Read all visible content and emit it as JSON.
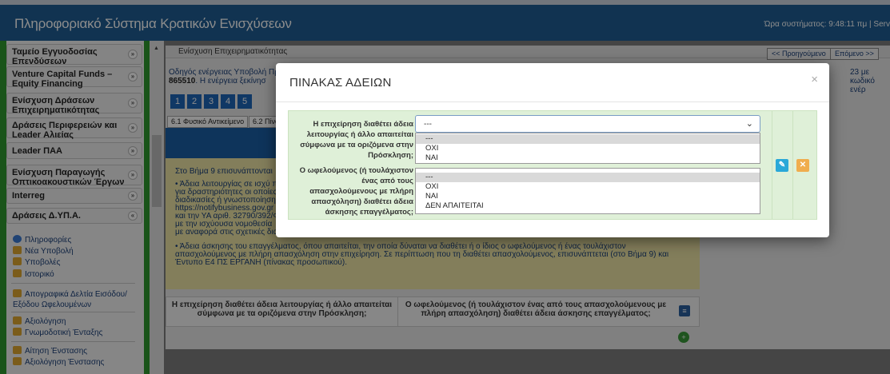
{
  "app": {
    "title": "Πληροφοριακό Σύστημα Κρατικών Ενισχύσεων",
    "clock": "Ώρα συστήματος: 9:48:11 πμ | Serv"
  },
  "sidebar": {
    "accordion": [
      {
        "label": "Ταμείο Εγγυοδοσίας Επενδύσεων (ΕΠΑνΕΚ/EIF)"
      },
      {
        "label": "Venture Capital Funds – Equity Financing"
      },
      {
        "label": "Ενίσχυση Δράσεων Επιχειρηματικότητας"
      },
      {
        "label": "Δράσεις Περιφερειών και Leader Αλιείας"
      },
      {
        "label": "Leader ΠΑΑ"
      },
      {
        "label": "Ενίσχυση Παραγωγής Οπτικοακουστικών Έργων"
      },
      {
        "label": "Interreg"
      },
      {
        "label": "Δράσεις Δ.ΥΠ.Α."
      }
    ],
    "menu": [
      {
        "label": "Πληροφορίες",
        "icon": "info-icon"
      },
      {
        "label": "Νέα Υποβολή",
        "icon": "folder-icon"
      },
      {
        "label": "Υποβολές",
        "icon": "folder-icon"
      },
      {
        "label": "Ιστορικό",
        "icon": "folder-icon"
      },
      {
        "label": "Απογραφικά Δελτία Εισόδου/ Εξόδου Ωφελουμένων",
        "icon": "folder-icon"
      },
      {
        "label": "Αξιολόγηση",
        "icon": "folder-icon"
      },
      {
        "label": "Γνωμοδοτική Ένταξης",
        "icon": "folder-icon"
      },
      {
        "label": "Αίτηση Ένστασης",
        "icon": "folder-icon"
      },
      {
        "label": "Αξιολόγηση Ένστασης",
        "icon": "folder-icon"
      }
    ]
  },
  "main": {
    "panel_title": "Ενίσχυση Επιχειρηματικότητας",
    "prev_label": "<< Προηγούμενο",
    "next_label": "Επόμενο >>",
    "guide_prefix": "Οδηγός ενέργειας Υποβολή Πρ",
    "guide_code": "865510",
    "guide_rest": ". Η ενέργεια ξεκίνησ",
    "guide_right": "23  με κωδικό ενέρ",
    "steps": [
      "1",
      "2",
      "3",
      "4",
      "5"
    ],
    "subtabs": [
      "6.1 Φυσικό Αντικείμενο",
      "6.2 Πίνα"
    ],
    "info_lines": [
      "Στο Βήμα 9 επισυνάπτονται",
      "• Άδεια λειτουργίας σε ισχύ π",
      "για δραστηριότητες οι οποίες",
      "διαδικασίες ή γνωστοποίηση",
      "https://notifybusiness.gov.gr",
      "και την ΥΑ αριθ. 32790/392/Φ",
      "με την ισχύουσα νομοθεσία",
      "με αναφορά στις σχετικές διατάξεις σύμφωνα με το Ν.4442/2016.",
      "• Άδεια άσκησης του επαγγέλματος, όπου απαιτείται, την οποία δύναται να διαθέτει ή ο ίδιος ο ωφελούμενος ή ένας τουλάχιστον",
      "απασχολούμενος με πλήρη απασχόληση στην επιχείρηση. Σε περίπτωση που τη διαθέτει απασχολούμενος, επισυνάπτεται (στο Βήμα 9) και",
      "Έντυπο Ε4 ΠΣ ΕΡΓΑΝΗ (πίνακας προσωπικού)."
    ],
    "grid_col1": "Η επιχείρηση διαθέτει άδεια λειτουργίας ή άλλο απαιτείται σύμφωνα με τα οριζόμενα στην Πρόσκληση;",
    "grid_col2": "Ο ωφελούμενος (ή τουλάχιστον ένας από τους απασχολούμενους με πλήρη απασχόληση) διαθέτει άδεια άσκησης επαγγέλματος;"
  },
  "modal": {
    "title": "ΠΙΝΑΚΑΣ ΑΔΕΙΩΝ",
    "close": "×",
    "q1_label": "Η επιχείρηση διαθέτει άδεια λειτουργίας ή άλλο απαιτείται σύμφωνα με τα οριζόμενα στην Πρόσκληση;",
    "q1_value": "---",
    "q1_options": [
      "---",
      "ΟΧΙ",
      "ΝΑΙ"
    ],
    "q2_label": "Ο ωφελούμενος (ή τουλάχιστον ένας από τους απασχολούμενους με πλήρη απασχόληση) διαθέτει άδεια άσκησης επαγγέλματος;",
    "q2_options": [
      "---",
      "ΟΧΙ",
      "ΝΑΙ",
      "ΔΕΝ ΑΠΑΙΤΕΙΤΑΙ"
    ]
  },
  "colors": {
    "header": "#1f5e94",
    "sidebar": "#2f9a2f",
    "form_bg": "#dff0d8",
    "edit_button": "#2aa8d8",
    "cancel_button": "#f0ad4e"
  }
}
